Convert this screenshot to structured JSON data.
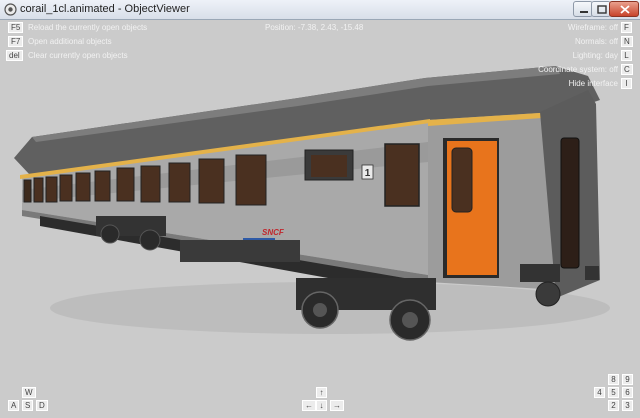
{
  "window": {
    "title": "corail_1cl.animated - ObjectViewer"
  },
  "left_hints": [
    {
      "key": "F5",
      "text": "Reload the currently open objects"
    },
    {
      "key": "F7",
      "text": "Open additional objects"
    },
    {
      "key": "del",
      "text": "Clear currently open objects"
    }
  ],
  "position_text": "Position: -7.38, 2.43, -15.48",
  "right_hints": [
    {
      "key": "F",
      "text": "Wireframe: off"
    },
    {
      "key": "N",
      "text": "Normals: off"
    },
    {
      "key": "L",
      "text": "Lighting: day"
    },
    {
      "key": "C",
      "text": "Coordinate system: off"
    },
    {
      "key": "I",
      "text": "Hide interface"
    }
  ],
  "nav_keys": {
    "wasd": {
      "w": "W",
      "a": "A",
      "s": "S",
      "d": "D"
    },
    "arrows": {
      "up": "↑",
      "left": "←",
      "down": "↓",
      "right": "→"
    },
    "numpad": [
      "8",
      "9",
      "4",
      "5",
      "6",
      "2",
      "3"
    ]
  },
  "model": {
    "logo": "SNCF",
    "class_label": "1",
    "colors": {
      "body": "#a9a9a9",
      "roof": "#5c5c5c",
      "stripe": "#e4b24a",
      "door": "#e8741c",
      "window": "#4a3020",
      "background": "#cbcbcb"
    }
  }
}
